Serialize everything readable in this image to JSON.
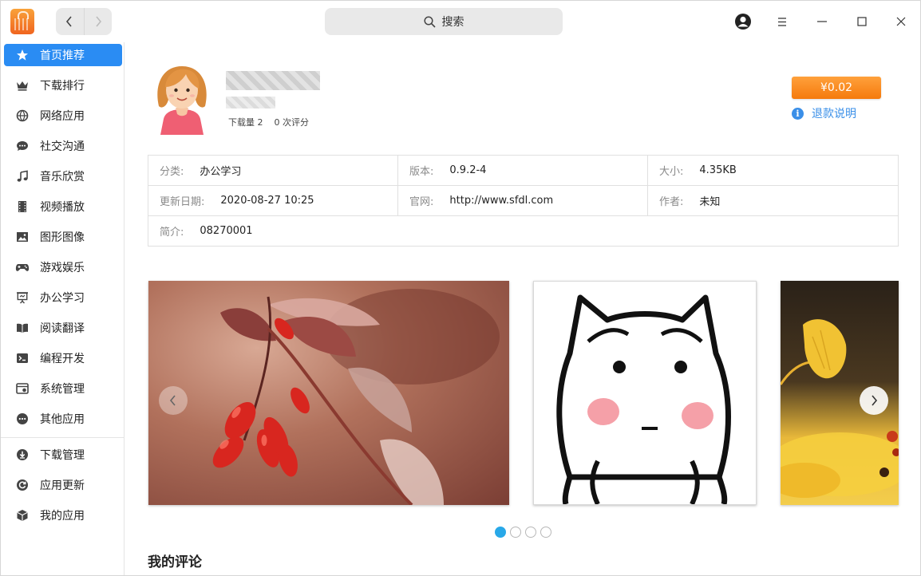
{
  "titlebar": {
    "search_label": "搜索",
    "nav_back_icon": "chevron-left-icon",
    "nav_forward_icon": "chevron-right-icon"
  },
  "sidebar": {
    "items": [
      {
        "label": "首页推荐",
        "icon": "star-icon",
        "active": true
      },
      {
        "label": "下载排行",
        "icon": "crown-icon"
      },
      {
        "label": "网络应用",
        "icon": "network-icon"
      },
      {
        "label": "社交沟通",
        "icon": "chat-icon"
      },
      {
        "label": "音乐欣赏",
        "icon": "music-icon"
      },
      {
        "label": "视频播放",
        "icon": "film-icon"
      },
      {
        "label": "图形图像",
        "icon": "image-icon"
      },
      {
        "label": "游戏娱乐",
        "icon": "gamepad-icon"
      },
      {
        "label": "办公学习",
        "icon": "presentation-icon"
      },
      {
        "label": "阅读翻译",
        "icon": "book-icon"
      },
      {
        "label": "编程开发",
        "icon": "terminal-icon"
      },
      {
        "label": "系统管理",
        "icon": "system-icon"
      },
      {
        "label": "其他应用",
        "icon": "more-icon"
      }
    ],
    "bottom_items": [
      {
        "label": "下载管理",
        "icon": "download-icon"
      },
      {
        "label": "应用更新",
        "icon": "update-icon"
      },
      {
        "label": "我的应用",
        "icon": "box-icon"
      }
    ]
  },
  "app": {
    "downloads": "下载量 2",
    "ratings": "0 次评分",
    "price": "¥0.02",
    "refund_label": "退款说明"
  },
  "info": {
    "category_key": "分类:",
    "category_val": "办公学习",
    "version_key": "版本:",
    "version_val": "0.9.2-4",
    "size_key": "大小:",
    "size_val": "4.35KB",
    "updated_key": "更新日期:",
    "updated_val": "2020-08-27 10:25",
    "website_key": "官网:",
    "website_val": "http://www.sfdl.com",
    "author_key": "作者:",
    "author_val": "未知",
    "intro_key": "简介:",
    "intro_val": "08270001"
  },
  "carousel": {
    "slide_count": 4,
    "active_index": 0
  },
  "comments": {
    "title": "我的评论"
  },
  "colors": {
    "accent": "#2a8cf3",
    "price": "#f57a0c",
    "link": "#3a8fe8",
    "dot_active": "#28a8e8"
  }
}
